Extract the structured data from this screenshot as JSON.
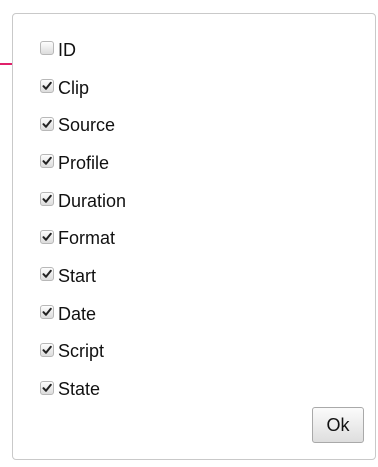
{
  "options": [
    {
      "label": "ID",
      "checked": false
    },
    {
      "label": "Clip",
      "checked": true
    },
    {
      "label": "Source",
      "checked": true
    },
    {
      "label": "Profile",
      "checked": true
    },
    {
      "label": "Duration",
      "checked": true
    },
    {
      "label": "Format",
      "checked": true
    },
    {
      "label": "Start",
      "checked": true
    },
    {
      "label": "Date",
      "checked": true
    },
    {
      "label": "Script",
      "checked": true
    },
    {
      "label": "State",
      "checked": true
    }
  ],
  "ok_button": {
    "label": "Ok"
  },
  "colors": {
    "arrow": "#e0206a",
    "panel_border": "#c9c9c9",
    "checkmark": "#222222"
  }
}
